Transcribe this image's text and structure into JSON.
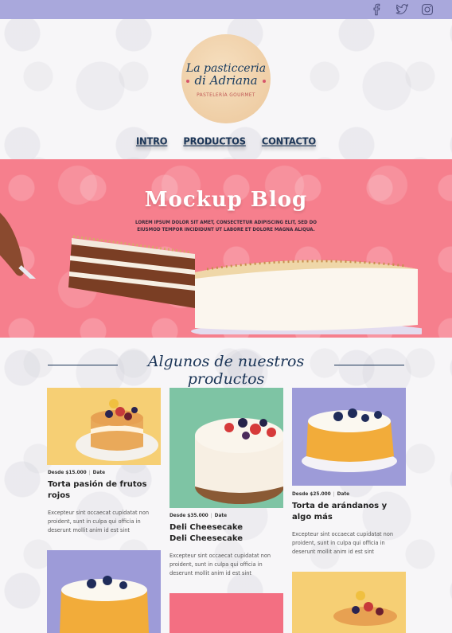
{
  "social": {
    "facebook_icon": "facebook-icon",
    "twitter_icon": "twitter-icon",
    "instagram_icon": "instagram-icon"
  },
  "logo": {
    "line1": "La pasticceria",
    "line2": "di Adriana",
    "subtitle": "PASTELERÍA GOURMET"
  },
  "nav": {
    "items": [
      "INTRO",
      "PRODUCTOS",
      "CONTACTO"
    ]
  },
  "hero": {
    "title": "Mockup Blog",
    "text": "Lorem ipsum dolor sit amet, consectetur adipiscing elit, sed do eiusmod tempor incididunt ut labore et dolore magna aliqua."
  },
  "section": {
    "title": "Algunos de nuestros productos"
  },
  "products": [
    {
      "price": "Desde $15.000",
      "date": "Date",
      "title_1": "Torta pasión de frutos",
      "title_2": "rojos",
      "desc_1": "Excepteur sint occaecat cupidatat non",
      "desc_2": "proident, sunt in culpa qui officia in",
      "desc_3": "deserunt mollit anim id est sint"
    },
    {
      "price": "Desde $35.000",
      "date": "Date",
      "title_1": "Deli Cheesecake",
      "title_2": "Deli Cheesecake",
      "desc_1": "Excepteur sint occaecat cupidatat non",
      "desc_2": "proident, sunt in culpa qui officia in",
      "desc_3": "deserunt mollit anim id est sint"
    },
    {
      "price": "Desde $25.000",
      "date": "Date",
      "title_1": "Torta de arándanos y",
      "title_2": "algo más",
      "desc_1": "Excepteur sint occaecat cupidatat non",
      "desc_2": "proident, sunt in culpa qui officia in",
      "desc_3": "deserunt mollit anim id est sint"
    }
  ],
  "colors": {
    "topbar": "#a9a8dc",
    "hero": "#f67f8d",
    "navy": "#1b3557",
    "card_yellow": "#f6cf74",
    "card_mint": "#7ec4a4",
    "card_lavender": "#9d9bd8",
    "card_pink": "#f36f82"
  }
}
